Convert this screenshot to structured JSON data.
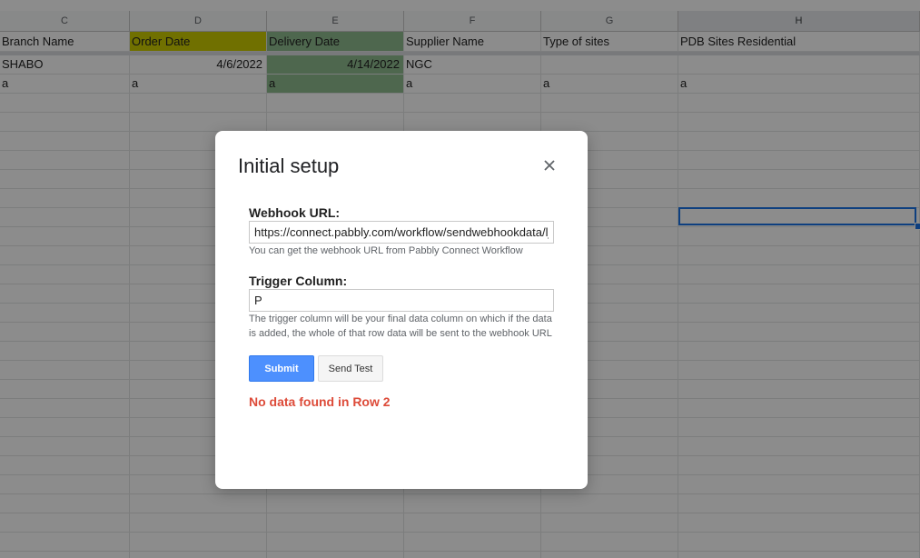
{
  "sheet": {
    "columns": [
      {
        "letter": "C",
        "header": "Branch Name",
        "header_bg": "#ffffff",
        "row2": "SHABO",
        "row3": "a",
        "cell_bg": "#ffffff",
        "align2": "left"
      },
      {
        "letter": "D",
        "header": "Order Date",
        "header_bg": "#cccc00",
        "row2": "4/6/2022",
        "row3": "a",
        "cell_bg": "#ffffff",
        "align2": "right"
      },
      {
        "letter": "E",
        "header": "Delivery Date",
        "header_bg": "#8fbc8f",
        "row2": "4/14/2022",
        "row3": "a",
        "cell_bg": "#8fbc8f",
        "align2": "right"
      },
      {
        "letter": "F",
        "header": "Supplier Name",
        "header_bg": "#ffffff",
        "row2": "NGC",
        "row3": "a",
        "cell_bg": "#ffffff",
        "align2": "left"
      },
      {
        "letter": "G",
        "header": "Type of sites",
        "header_bg": "#ffffff",
        "row2": "",
        "row3": "a",
        "cell_bg": "#ffffff",
        "align2": "left"
      },
      {
        "letter": "H",
        "header": "PDB Sites Residential",
        "header_bg": "#ffffff",
        "row2": "",
        "row3": "a",
        "cell_bg": "#ffffff",
        "align2": "left"
      }
    ],
    "selected_column": "H",
    "selection_border_color": "#1a73e8"
  },
  "dialog": {
    "title": "Initial setup",
    "close_icon": "close-icon",
    "webhook_label": "Webhook URL:",
    "webhook_value": "https://connect.pabbly.com/workflow/sendwebhookdata/lj",
    "webhook_help": "You can get the webhook URL from Pabbly Connect Workflow",
    "trigger_label": "Trigger Column:",
    "trigger_value": "P",
    "trigger_help": "The trigger column will be your final data column on which if the data is added, the whole of that row data will be sent to the webhook URL",
    "submit_label": "Submit",
    "send_test_label": "Send Test",
    "error_message": "No data found in Row 2",
    "error_color": "#dd4b39",
    "submit_color": "#4d90fe"
  }
}
